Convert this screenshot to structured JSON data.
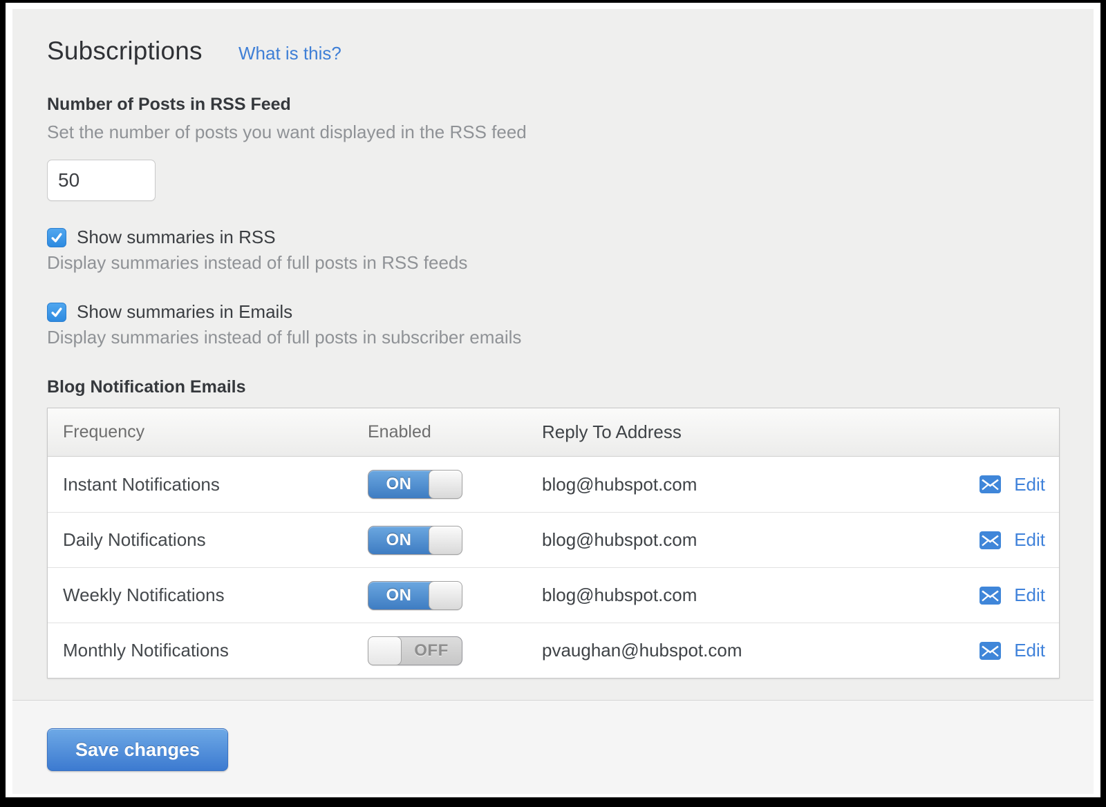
{
  "page": {
    "title": "Subscriptions",
    "help_link": "What is this?"
  },
  "rss_posts": {
    "heading": "Number of Posts in RSS Feed",
    "description": "Set the number of posts you want displayed in the RSS feed",
    "value": "50"
  },
  "checkboxes": [
    {
      "label": "Show summaries in RSS",
      "description": "Display summaries instead of full posts in RSS feeds",
      "checked": true
    },
    {
      "label": "Show summaries in Emails",
      "description": "Display summaries instead of full posts in subscriber emails",
      "checked": true
    }
  ],
  "notifications": {
    "heading": "Blog Notification Emails",
    "columns": [
      "Frequency",
      "Enabled",
      "Reply To Address"
    ],
    "toggle_on_label": "ON",
    "toggle_off_label": "OFF",
    "rows": [
      {
        "frequency": "Instant Notifications",
        "enabled": true,
        "reply_to": "blog@hubspot.com",
        "edit_label": "Edit"
      },
      {
        "frequency": "Daily Notifications",
        "enabled": true,
        "reply_to": "blog@hubspot.com",
        "edit_label": "Edit"
      },
      {
        "frequency": "Weekly Notifications",
        "enabled": true,
        "reply_to": "blog@hubspot.com",
        "edit_label": "Edit"
      },
      {
        "frequency": "Monthly Notifications",
        "enabled": false,
        "reply_to": "pvaughan@hubspot.com",
        "edit_label": "Edit"
      }
    ]
  },
  "footer": {
    "save_label": "Save changes"
  },
  "colors": {
    "link_blue": "#3f7fd6",
    "checkbox_blue": "#2d8ae0",
    "toggle_blue": "#3e7cc2",
    "button_blue": "#3c7ad0",
    "envelope_blue": "#3f86d9",
    "panel_gray": "#efefee"
  }
}
